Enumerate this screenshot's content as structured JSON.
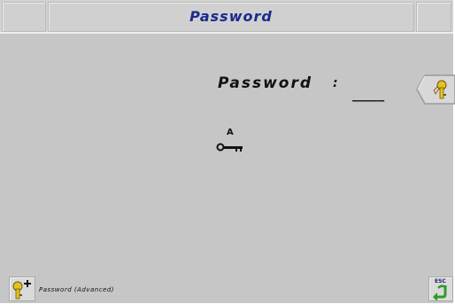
{
  "header": {
    "title": "Password"
  },
  "password": {
    "label": "Password",
    "colon": ":",
    "value": "____"
  },
  "access": {
    "level": "A"
  },
  "footer": {
    "advanced_label": "Password (Advanced)"
  },
  "icons": {
    "password_entry": "key-with-hand-icon",
    "access_level": "key-icon",
    "advanced": "key-plus-icon",
    "escape": "esc-return-icon"
  },
  "colors": {
    "background": "#c6c6c6",
    "title_text": "#1a2a8c",
    "icon_green": "#2f9a2a",
    "icon_yellow": "#e6c21e"
  }
}
